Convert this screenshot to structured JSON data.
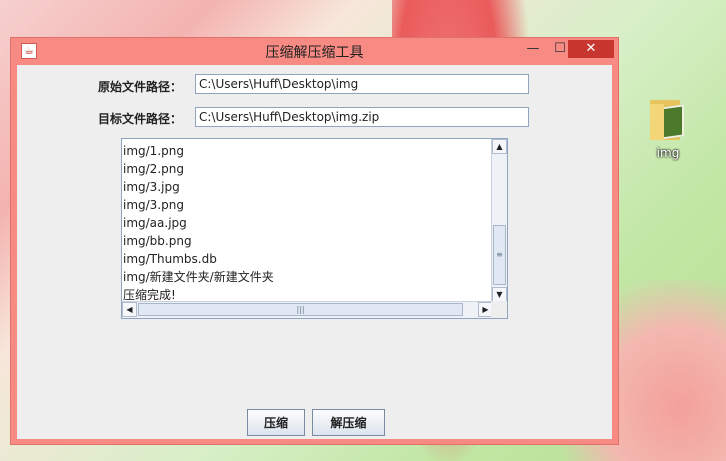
{
  "window": {
    "title": "压缩解压缩工具",
    "minimize": "—",
    "maximize": "☐",
    "close": "✕"
  },
  "form": {
    "source_label": "原始文件路径：",
    "source_value": "C:\\Users\\Huff\\Desktop\\img",
    "target_label": "目标文件路径：",
    "target_value": "C:\\Users\\Huff\\Desktop\\img.zip"
  },
  "log_lines": [
    "img/1.png",
    "img/2.png",
    "img/3.jpg",
    "img/3.png",
    "img/aa.jpg",
    "img/bb.png",
    "img/Thumbs.db",
    "img/新建文件夹/新建文件夹",
    "压缩完成!"
  ],
  "buttons": {
    "compress": "压缩",
    "decompress": "解压缩"
  },
  "desktop": {
    "folder_label": "img"
  },
  "icons": {
    "app": "java-icon",
    "folder": "folder-icon"
  }
}
